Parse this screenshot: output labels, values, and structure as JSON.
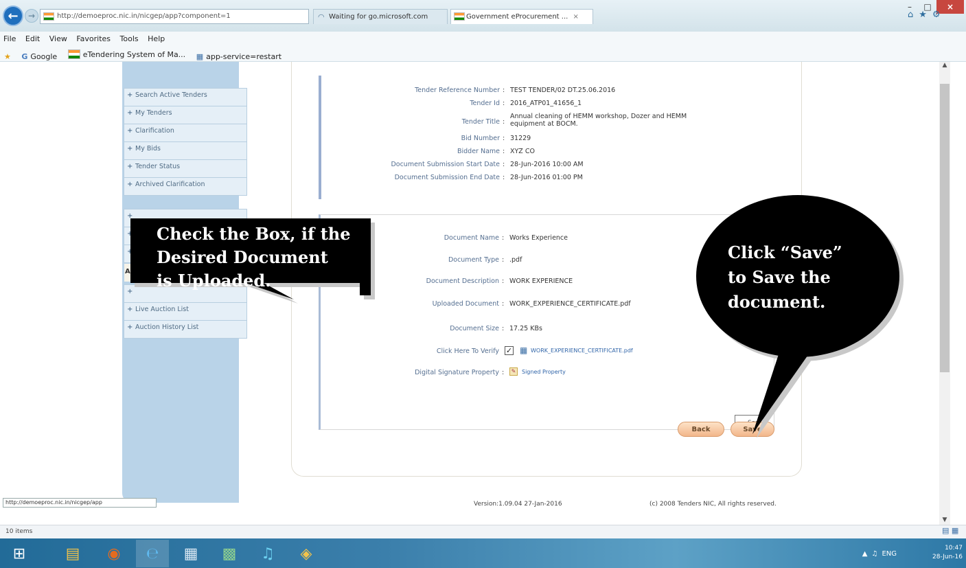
{
  "browser": {
    "address": "http://demoeproc.nic.in/nicgep/app?component=1",
    "tabs": [
      "Waiting for go.microsoft.com",
      "Government eProcurement ..."
    ],
    "menu": [
      "File",
      "Edit",
      "View",
      "Favorites",
      "Tools",
      "Help"
    ],
    "favorites": [
      "Google",
      "eTendering System of Ma...",
      "app-service=restart"
    ],
    "status_url": "http://demoeproc.nic.in/nicgep/app",
    "item_count": "10 items"
  },
  "sidebar": {
    "items": [
      "Search Active Tenders",
      "My Tenders",
      "Clarification",
      "My Bids",
      "Tender Status",
      "Archived Clarification",
      "Live Auction List",
      "Auction History List"
    ],
    "highlight": "A"
  },
  "tender": {
    "rows": [
      {
        "label": "Tender Reference Number",
        "value": "TEST TENDER/02 DT.25.06.2016"
      },
      {
        "label": "Tender Id",
        "value": "2016_ATP01_41656_1"
      },
      {
        "label": "Tender Title",
        "value": "Annual cleaning of HEMM workshop, Dozer and HEMM",
        "value2": "equipment at BOCM."
      },
      {
        "label": "Bid Number",
        "value": "31229"
      },
      {
        "label": "Bidder Name",
        "value": "XYZ CO"
      },
      {
        "label": "Document Submission Start Date",
        "value": "28-Jun-2016 10:00 AM"
      },
      {
        "label": "Document Submission End Date",
        "value": "28-Jun-2016 01:00 PM"
      }
    ]
  },
  "document": {
    "rows": [
      {
        "label": "Document Name",
        "value": "Works Experience"
      },
      {
        "label": "Document Type",
        "value": ".pdf"
      },
      {
        "label": "Document Description",
        "value": "WORK EXPERIENCE"
      },
      {
        "label": "Uploaded Document",
        "value": "WORK_EXPERIENCE_CERTIFICATE.pdf"
      },
      {
        "label": "Document Size",
        "value": "17.25 KBs"
      }
    ],
    "verify_label": "Click Here To Verify",
    "verify_link": "WORK_EXPERIENCE_CERTIFICATE.pdf",
    "signature_label": "Digital Signature Property",
    "signature_link": "Signed Property"
  },
  "buttons": {
    "save_small": "Sav",
    "back": "Back",
    "save": "Save"
  },
  "footer": {
    "version": "Version:1.09.04 27-Jan-2016",
    "copyright": "(c) 2008 Tenders NIC, All rights reserved."
  },
  "callouts": {
    "left": [
      "Check the Box, if the",
      "Desired Document",
      "is Uploaded."
    ],
    "right": [
      "Click “Save”",
      "to Save the",
      "document."
    ]
  },
  "clock": {
    "time": "10:47",
    "date": "28-Jun-16"
  },
  "tray": {
    "lang": "ENG"
  },
  "colors": {
    "sidebar": "#b9d3e8",
    "close_button": "#c7473f",
    "button_orange": "#f2b68a",
    "taskbar": "#3b7fab"
  }
}
